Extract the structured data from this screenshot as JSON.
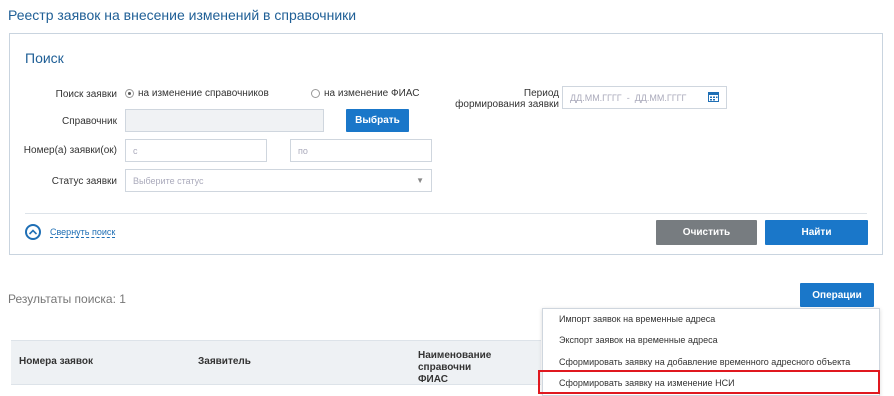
{
  "page": {
    "title": "Реестр заявок на внесение изменений в справочники"
  },
  "search": {
    "title": "Поиск",
    "type_label": "Поиск заявки",
    "radio_options": [
      {
        "label": "на изменение справочников",
        "checked": true
      },
      {
        "label": "на изменение ФИАС",
        "checked": false
      }
    ],
    "reference_label": "Справочник",
    "reference_value": "",
    "select_button": "Выбрать",
    "number_label": "Номер(а) заявки(ок)",
    "number_from_placeholder": "с",
    "number_to_placeholder": "по",
    "status_label": "Статус заявки",
    "status_placeholder": "Выберите статус",
    "period_label_line1": "Период",
    "period_label_line2": "формирования заявки",
    "period_from_placeholder": "ДД.ММ.ГГГГ",
    "period_separator": "-",
    "period_to_placeholder": "ДД.ММ.ГГГГ",
    "collapse_label": "Свернуть поиск",
    "clear_button": "Очистить",
    "find_button": "Найти"
  },
  "results": {
    "label": "Результаты поиска: 1",
    "operations_button": "Операции",
    "columns": [
      "Номера заявок",
      "Заявитель",
      "Наименование справочни",
      "ФИАС"
    ]
  },
  "operations_menu": {
    "items": [
      "Импорт заявок на временные адреса",
      "Экспорт заявок на временные адреса",
      "Сформировать заявку на добавление временного адресного объекта",
      "Сформировать заявку на изменение НСИ"
    ],
    "highlighted_index": 3,
    "highlight_color": "#e0181f"
  },
  "colors": {
    "accent": "#1a77c9",
    "title": "#1f5f96",
    "secondary_button": "#777c80"
  }
}
